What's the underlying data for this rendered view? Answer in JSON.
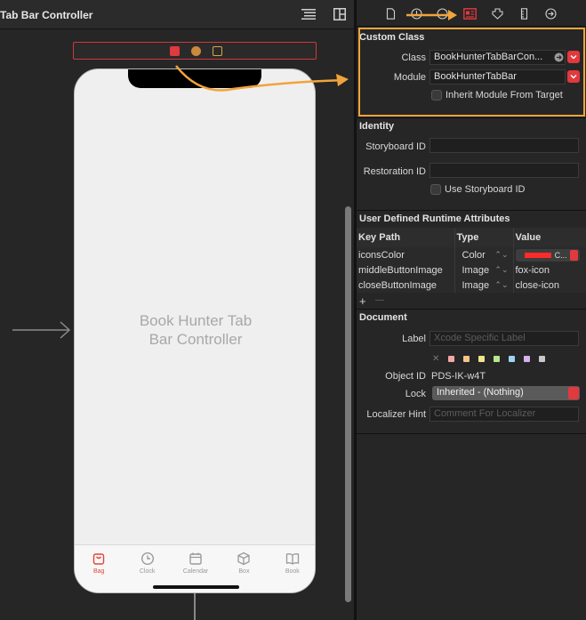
{
  "canvas": {
    "scene_title": "Tab Bar Controller",
    "phone_label_line1": "Book Hunter Tab",
    "phone_label_line2": "Bar Controller",
    "tabs": [
      {
        "label": "Bag",
        "icon": "bag-icon",
        "active": true
      },
      {
        "label": "Clock",
        "icon": "clock-icon",
        "active": false
      },
      {
        "label": "Calendar",
        "icon": "calendar-icon",
        "active": false
      },
      {
        "label": "Box",
        "icon": "box-icon",
        "active": false
      },
      {
        "label": "Book",
        "icon": "book-icon",
        "active": false
      }
    ]
  },
  "inspector": {
    "custom_class": {
      "title": "Custom Class",
      "class_label": "Class",
      "class_value": "BookHunterTabBarCon...",
      "module_label": "Module",
      "module_value": "BookHunterTabBar",
      "inherit_label": "Inherit Module From Target"
    },
    "identity": {
      "title": "Identity",
      "storyboard_id_label": "Storyboard ID",
      "restoration_id_label": "Restoration ID",
      "use_storyboard_id_label": "Use Storyboard ID"
    },
    "runtime_attributes": {
      "title": "User Defined Runtime Attributes",
      "headers": [
        "Key Path",
        "Type",
        "Value"
      ],
      "rows": [
        {
          "key": "iconsColor",
          "type": "Color",
          "value": "C..."
        },
        {
          "key": "middleButtonImage",
          "type": "Image",
          "value": "fox-icon"
        },
        {
          "key": "closeButtonImage",
          "type": "Image",
          "value": "close-icon"
        }
      ],
      "add_symbol": "+",
      "remove_symbol": "—"
    },
    "document": {
      "title": "Document",
      "label_label": "Label",
      "label_placeholder": "Xcode Specific Label",
      "object_id_label": "Object ID",
      "object_id_value": "PDS-IK-w4T",
      "lock_label": "Lock",
      "lock_value": "Inherited - (Nothing)",
      "localizer_label": "Localizer Hint",
      "localizer_placeholder": "Comment For Localizer",
      "swatch_colors": [
        "#f2a7a7",
        "#f6c48a",
        "#efe48c",
        "#b9e58d",
        "#9fd3f2",
        "#d4b2f0",
        "#c8c8c8"
      ]
    }
  },
  "colors": {
    "accent_orange": "#f0a43c",
    "xcode_red": "#e0393e",
    "icons_color_value": "#ff2a2a"
  }
}
